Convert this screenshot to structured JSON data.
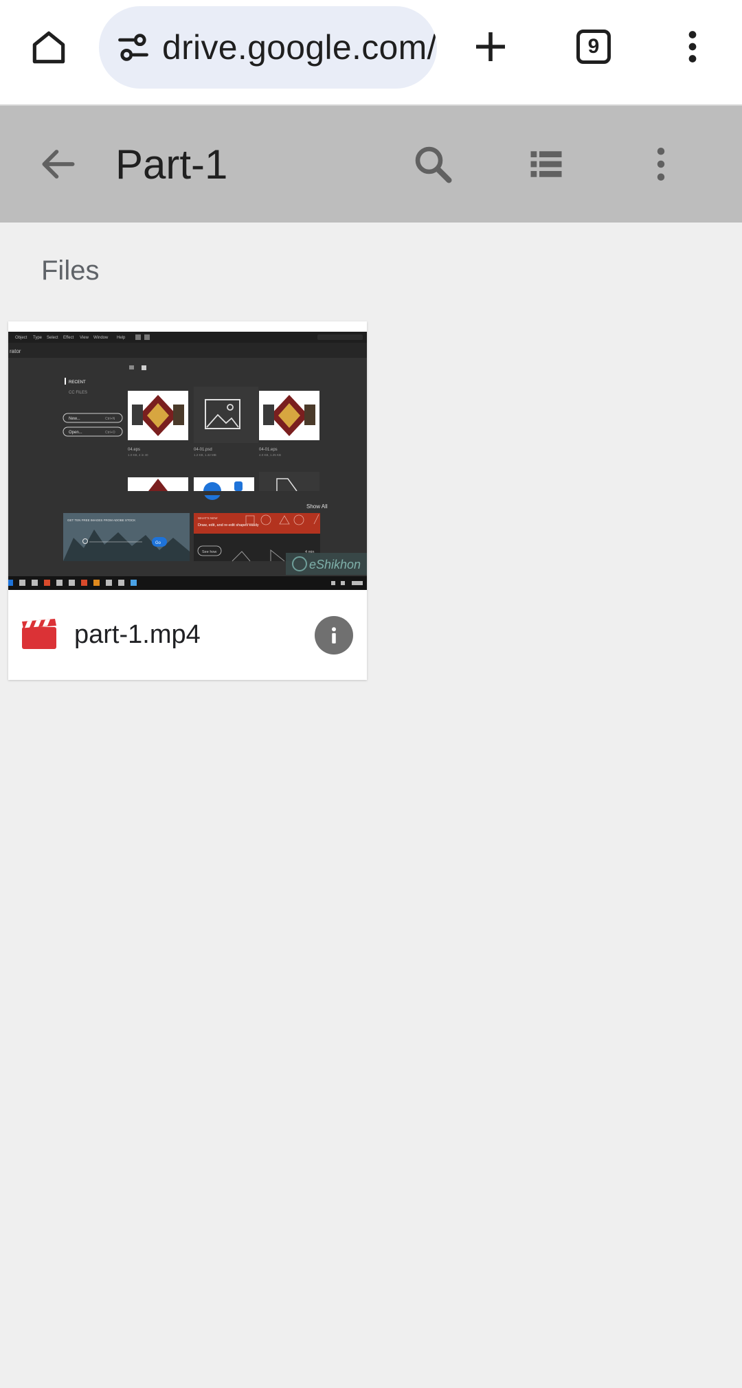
{
  "browser": {
    "url": "drive.google.com/",
    "tab_count": "9"
  },
  "app_bar": {
    "title": "Part-1"
  },
  "content": {
    "section_label": "Files",
    "files": [
      {
        "name": "part-1.mp4",
        "type": "video"
      }
    ]
  },
  "thumbnail": {
    "menu_items": [
      "Object",
      "Type",
      "Select",
      "Effect",
      "View",
      "Window",
      "Help"
    ],
    "app_label": "rator",
    "recent_label": "RECENT",
    "cc_files_label": "CC FILES",
    "new_button": "New...",
    "new_shortcut": "Ctrl+N",
    "open_button": "Open...",
    "open_shortcut": "Ctrl+O",
    "file1_name": "04.eps",
    "file1_meta": "1.0 KB, 4 in 40",
    "file2_name": "04-01.psd",
    "file2_meta": "1.2 KB, 1.32 MB",
    "file3_name": "04-01.eps",
    "file3_meta": "4.0 KB, 1.25 KB",
    "show_all": "Show All",
    "banner_left": "GET TEN FREE IMAGES FROM ADOBE STOCK",
    "banner_left_button": "Go",
    "banner_right_title": "WHAT'S NEW",
    "banner_right_sub": "Draw, edit, and re-edit shapes easily",
    "see_how": "See how",
    "duration": "4 min",
    "watermark": "eShikhon"
  },
  "colors": {
    "browser_bg": "#ffffff",
    "omnibox_bg": "#e9edf7",
    "app_bar_bg": "#bdbdbd",
    "page_bg": "#efefef",
    "video_icon": "#db3236",
    "info_btn": "#707070"
  },
  "icons": {
    "home": "home-icon",
    "site_settings": "tune-icon",
    "new_tab": "plus-icon",
    "tabs": "tab-switcher-icon",
    "menu": "more-vert-icon",
    "back": "arrow-back-icon",
    "search": "search-icon",
    "list_view": "list-view-icon",
    "more": "more-vert-icon",
    "file_type": "video-file-icon",
    "info": "info-icon"
  }
}
